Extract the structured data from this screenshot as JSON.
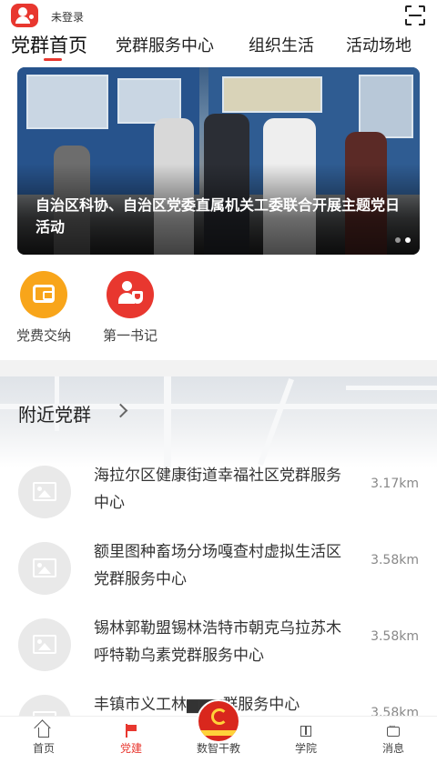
{
  "header": {
    "login_status": "未登录"
  },
  "tabs": [
    {
      "label": "党群首页",
      "active": true
    },
    {
      "label": "党群服务中心",
      "active": false
    },
    {
      "label": "组织生活",
      "active": false
    },
    {
      "label": "活动场地",
      "active": false
    }
  ],
  "banner": {
    "caption": "自治区科协、自治区党委直属机关工委联合开展主题党日活动",
    "page_count": 2,
    "current_page": 2
  },
  "quick_actions": [
    {
      "label": "党费交纳",
      "icon": "wallet-icon",
      "color": "#f8a51a"
    },
    {
      "label": "第一书记",
      "icon": "secretary-icon",
      "color": "#e8372f"
    }
  ],
  "nearby": {
    "title": "附近党群",
    "items": [
      {
        "name": "海拉尔区健康街道幸福社区党群服务中心",
        "distance": "3.17km"
      },
      {
        "name": "额里图种畜场分场嘎查村虚拟生活区党群服务中心",
        "distance": "3.58km"
      },
      {
        "name": "锡林郭勒盟锡林浩特市朝克乌拉苏木呼特勒乌素党群服务中心",
        "distance": "3.58km"
      },
      {
        "name": "丰镇市义工林▆▆▆群服务中心",
        "distance": "3.58km"
      }
    ]
  },
  "bottom_nav": [
    {
      "label": "首页",
      "icon": "home-icon",
      "active": false
    },
    {
      "label": "党建",
      "icon": "flag-icon",
      "active": true
    },
    {
      "label": "数智干教",
      "icon": "party-emblem-icon",
      "active": false
    },
    {
      "label": "学院",
      "icon": "school-icon",
      "active": false
    },
    {
      "label": "消息",
      "icon": "message-icon",
      "active": false
    }
  ],
  "colors": {
    "accent": "#e8372f",
    "orange": "#f8a51a"
  }
}
